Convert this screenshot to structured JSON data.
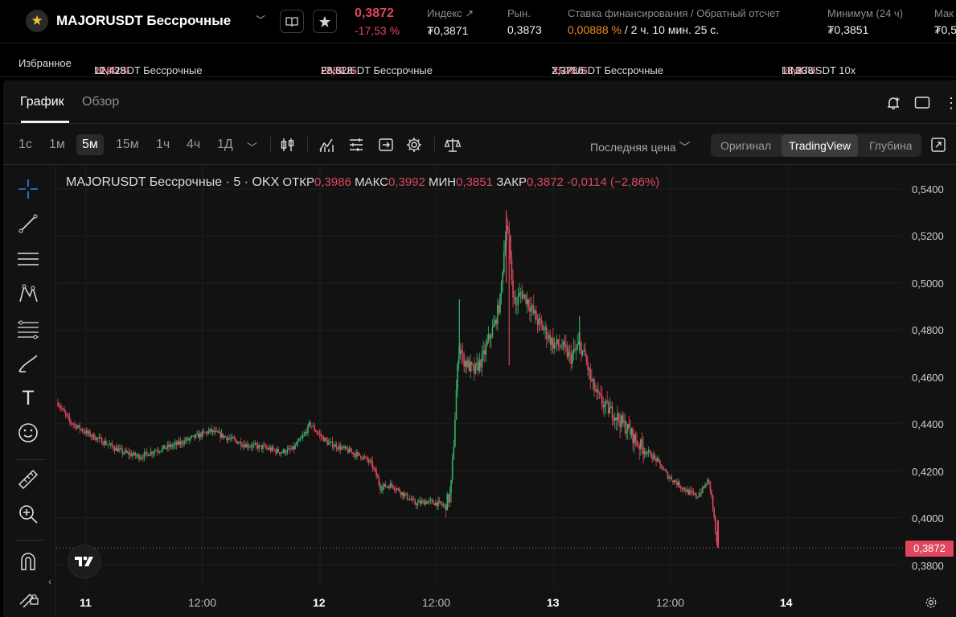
{
  "header": {
    "symbol": "MAJORUSDT Бессрочные",
    "last_price": "0,3872",
    "change_pct": "-17,53 %",
    "index_label": "Индекс",
    "index_value": "₮0,3871",
    "market_label": "Рын.",
    "market_value": "0,3873",
    "funding_label": "Ставка финансирования / Обратный отсчет",
    "funding_rate": "0,00888 %",
    "funding_countdown": " / 2 ч. 10 мин. 25 с.",
    "low_label": "Минимум (24 ч)",
    "low_value": "₮0,3851",
    "high_label": "Мак",
    "high_value": "₮0,5",
    "accent_negative": "#e0475f",
    "accent_orange": "#f08a24"
  },
  "ticker": {
    "favorites_label": "Избранное",
    "items": [
      {
        "name": "UNIUSDT Бессрочные",
        "pct": "-9,65 %",
        "price": "12,428"
      },
      {
        "name": "ENSUSDT Бессрочные",
        "pct": "-9,88 %",
        "price": "28,828"
      },
      {
        "name": "XRPUSDT Бессрочные",
        "pct": "-5,20 %",
        "price": "2,3786"
      },
      {
        "name": "LINK/USDT 10x",
        "pct": "-8,41 %",
        "price": "18,338"
      }
    ]
  },
  "tabs": {
    "chart": "График",
    "overview": "Обзор"
  },
  "toolbar": {
    "timeframes": [
      "1с",
      "1м",
      "5м",
      "15м",
      "1ч",
      "4ч",
      "1Д"
    ],
    "selected_timeframe": "5м",
    "price_source": "Последняя цена",
    "views": [
      "Оригинал",
      "TradingView",
      "Глубина"
    ],
    "selected_view": "TradingView"
  },
  "legend": {
    "title": "MAJORUSDT Бессрочные · 5 · OKX",
    "open_label": "ОТКР",
    "open": "0,3986",
    "high_label": "МАКС",
    "high": "0,3992",
    "low_label": "МИН",
    "low": "0,3851",
    "close_label": "ЗАКР",
    "close": "0,3872",
    "change": "-0,0114 (−2,86%)"
  },
  "chart_data": {
    "type": "candlestick",
    "ylim": [
      0.375,
      0.545
    ],
    "yticks": [
      "0,5400",
      "0,5200",
      "0,5000",
      "0,4800",
      "0,4600",
      "0,4400",
      "0,4200",
      "0,4000",
      "0,3800"
    ],
    "xticks": [
      "11",
      "12:00",
      "12",
      "12:00",
      "13",
      "12:00",
      "14"
    ],
    "last_price_tag": "0,3872",
    "up_color": "#2fb36a",
    "down_color": "#e0475f",
    "path": [
      [
        0.0,
        0.449
      ],
      [
        0.02,
        0.441
      ],
      [
        0.05,
        0.436
      ],
      [
        0.08,
        0.432
      ],
      [
        0.11,
        0.428
      ],
      [
        0.14,
        0.426
      ],
      [
        0.17,
        0.429
      ],
      [
        0.2,
        0.431
      ],
      [
        0.23,
        0.434
      ],
      [
        0.26,
        0.437
      ],
      [
        0.29,
        0.434
      ],
      [
        0.32,
        0.431
      ],
      [
        0.35,
        0.43
      ],
      [
        0.38,
        0.428
      ],
      [
        0.4,
        0.429
      ],
      [
        0.42,
        0.435
      ],
      [
        0.43,
        0.44
      ],
      [
        0.44,
        0.437
      ],
      [
        0.46,
        0.432
      ],
      [
        0.48,
        0.43
      ],
      [
        0.5,
        0.428
      ],
      [
        0.52,
        0.426
      ],
      [
        0.535,
        0.423
      ],
      [
        0.545,
        0.417
      ],
      [
        0.55,
        0.413
      ],
      [
        0.57,
        0.414
      ],
      [
        0.59,
        0.41
      ],
      [
        0.61,
        0.406
      ],
      [
        0.63,
        0.407
      ],
      [
        0.65,
        0.406
      ],
      [
        0.66,
        0.405
      ],
      [
        0.67,
        0.41
      ],
      [
        0.675,
        0.43
      ],
      [
        0.68,
        0.455
      ],
      [
        0.685,
        0.475
      ],
      [
        0.69,
        0.468
      ],
      [
        0.7,
        0.465
      ],
      [
        0.71,
        0.462
      ],
      [
        0.725,
        0.468
      ],
      [
        0.735,
        0.476
      ],
      [
        0.745,
        0.482
      ],
      [
        0.755,
        0.493
      ],
      [
        0.76,
        0.51
      ],
      [
        0.765,
        0.526
      ],
      [
        0.77,
        0.518
      ],
      [
        0.775,
        0.5
      ],
      [
        0.78,
        0.49
      ],
      [
        0.79,
        0.496
      ],
      [
        0.8,
        0.493
      ],
      [
        0.81,
        0.488
      ],
      [
        0.82,
        0.483
      ],
      [
        0.83,
        0.48
      ],
      [
        0.845,
        0.474
      ],
      [
        0.86,
        0.473
      ],
      [
        0.875,
        0.468
      ],
      [
        0.89,
        0.474
      ],
      [
        0.9,
        0.468
      ],
      [
        0.91,
        0.458
      ],
      [
        0.92,
        0.452
      ],
      [
        0.935,
        0.447
      ],
      [
        0.95,
        0.444
      ],
      [
        0.96,
        0.441
      ],
      [
        0.975,
        0.437
      ],
      [
        0.985,
        0.433
      ],
      [
        1.0,
        0.429
      ],
      [
        1.02,
        0.425
      ],
      [
        1.04,
        0.418
      ],
      [
        1.06,
        0.414
      ],
      [
        1.075,
        0.411
      ],
      [
        1.09,
        0.409
      ],
      [
        1.1,
        0.412
      ],
      [
        1.11,
        0.416
      ],
      [
        1.115,
        0.41
      ],
      [
        1.12,
        0.399
      ],
      [
        1.125,
        0.387
      ]
    ]
  }
}
